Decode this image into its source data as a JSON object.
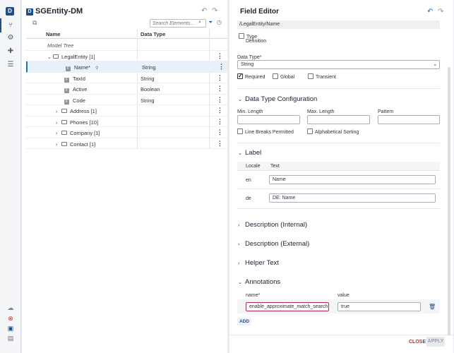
{
  "rail": {
    "logo": "D",
    "icons": [
      "tree-icon",
      "gear-icon",
      "puzzle-icon",
      "list-icon"
    ],
    "bottom_icons": [
      "cloud-upload-icon",
      "error-icon",
      "save-as-icon",
      "save-icon"
    ]
  },
  "left": {
    "title": "SGEntity-DM",
    "search_placeholder": "Search Elements...",
    "columns": {
      "name": "Name",
      "type": "Data Type"
    },
    "rows": [
      {
        "label": "Model Tree"
      },
      {
        "label": "LegalEntity [1]"
      },
      {
        "label": "Name*",
        "type": "String"
      },
      {
        "label": "TaxId",
        "type": "String"
      },
      {
        "label": "Active",
        "type": "Boolean"
      },
      {
        "label": "Code",
        "type": "String"
      },
      {
        "label": "Address [1]"
      },
      {
        "label": "Phones [10]"
      },
      {
        "label": "Company [1]"
      },
      {
        "label": "Contact [1]"
      }
    ]
  },
  "right": {
    "title": "Field Editor",
    "path": "/LegalEntity/Name",
    "type_definition": "Type Definition",
    "type_label": "Type",
    "definition_label": "Definition",
    "data_type_label": "Data Type*",
    "data_type_value": "String",
    "flags": {
      "required": "Required",
      "global": "Global",
      "transient": "Transient"
    },
    "dtc": {
      "title": "Data Type Configuration",
      "min_length": "Min. Length",
      "max_length": "Max. Length",
      "pattern": "Pattern",
      "line_breaks": "Line Breaks Permitted",
      "alpha_sort": "Alphabetical Sorting"
    },
    "label": {
      "title": "Label",
      "col_locale": "Locale",
      "col_text": "Text",
      "rows": [
        {
          "locale": "en",
          "text": "Name"
        },
        {
          "locale": "de",
          "text": "DE: Name"
        }
      ]
    },
    "sections": {
      "desc_internal": "Description (Internal)",
      "desc_external": "Description (External)",
      "helper_text": "Helper Text"
    },
    "annotations": {
      "title": "Annotations",
      "col_name": "name*",
      "col_value": "value",
      "name_value": "enable_approximate_match_search",
      "value_value": "true",
      "add": "ADD"
    },
    "footer": {
      "close": "CLOSE",
      "apply": "APPLY"
    }
  }
}
